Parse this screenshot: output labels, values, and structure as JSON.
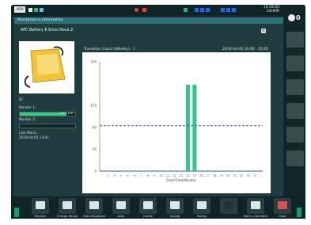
{
  "status": {
    "badge": "ADM",
    "clock_time": "10:29:20",
    "clock_sub": "24HMR"
  },
  "alarm": {
    "count": "0"
  },
  "window": {
    "title": "Maintenance Information",
    "panel_title": "APC Battery 8 Smss Nova Z"
  },
  "left_panel": {
    "item_label": "ID",
    "monitor1_label": "Monitor 1:",
    "monitor1_value_text": "100 / 100",
    "monitor1_fill": 0.84,
    "monitor2_label": "Monitor 2:",
    "monitor2_fill": 0.0,
    "last_maint_label": "Last Maint.:",
    "last_maint_value": "2019-04-05 13:01"
  },
  "chart_header": {
    "title": "Transition Count (Weekly) - 1",
    "time_range": "2019-04-05 10:00 - 15:05"
  },
  "chart_data": {
    "type": "bar",
    "x_tick_labels": [
      "2",
      "3",
      "4",
      "5",
      "6",
      "7",
      "8",
      "9",
      "10",
      "11",
      "12",
      "13",
      "14",
      "15",
      "16",
      "17",
      "18",
      "19",
      "20",
      "21",
      "22",
      "23",
      "24"
    ],
    "bars": [
      {
        "x": 14,
        "value": 158
      },
      {
        "x": 15,
        "value": 158
      }
    ],
    "threshold": 83,
    "y_tick_labels": [
      "0",
      "40",
      "80",
      "120",
      "200"
    ],
    "xlabel": "Date/Time(Minute)",
    "ylim": [
      0,
      200
    ],
    "colors": {
      "bar": "#2fc58b",
      "threshold": "#3a4dbf",
      "axis": "#3a4dbf"
    }
  },
  "bottom_bar": {
    "buttons": [
      {
        "label": "Machine",
        "icon": "machine-icon"
      },
      {
        "label": "Change Range",
        "icon": "bars-chart-icon"
      },
      {
        "label": "Data Displayed",
        "icon": "data-display-icon"
      },
      {
        "label": "Data",
        "icon": "data-icon"
      },
      {
        "label": "Locate",
        "icon": "locate-icon"
      },
      {
        "label": "Update",
        "icon": "update-icon"
      },
      {
        "label": "History",
        "icon": "history-icon"
      },
      {
        "label": "",
        "icon": "blank-icon"
      },
      {
        "label": "Maint. Comment",
        "icon": "comment-icon"
      },
      {
        "label": "Close",
        "icon": "close-icon"
      }
    ]
  }
}
